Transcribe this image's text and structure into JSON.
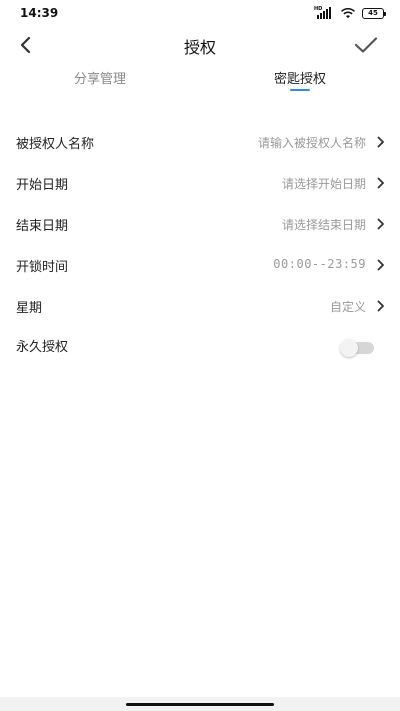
{
  "status_bar": {
    "time": "14:39",
    "network_label": "HD",
    "battery_level": "45",
    "icons": [
      "signal-icon",
      "wifi-icon",
      "battery-icon"
    ]
  },
  "nav": {
    "title": "授权",
    "back_icon": "chevron-left-icon",
    "confirm_icon": "checkmark-icon"
  },
  "tabs": [
    {
      "label": "分享管理",
      "active": false
    },
    {
      "label": "密匙授权",
      "active": true
    }
  ],
  "colors": {
    "accent": "#2f8de4",
    "placeholder": "#999999",
    "label": "#222222",
    "inactive_tab": "#888888",
    "toggle_track": "#d6d6d6"
  },
  "form": {
    "rows": [
      {
        "label": "被授权人名称",
        "value": "请输入被授权人名称",
        "has_arrow": true
      },
      {
        "label": "开始日期",
        "value": "请选择开始日期",
        "has_arrow": true
      },
      {
        "label": "结束日期",
        "value": "请选择结束日期",
        "has_arrow": true
      },
      {
        "label": "开锁时间",
        "value": "00:00--23:59",
        "has_arrow": true
      },
      {
        "label": "星期",
        "value": "自定义",
        "has_arrow": true
      }
    ],
    "permanent": {
      "label": "永久授权",
      "enabled": false
    }
  }
}
